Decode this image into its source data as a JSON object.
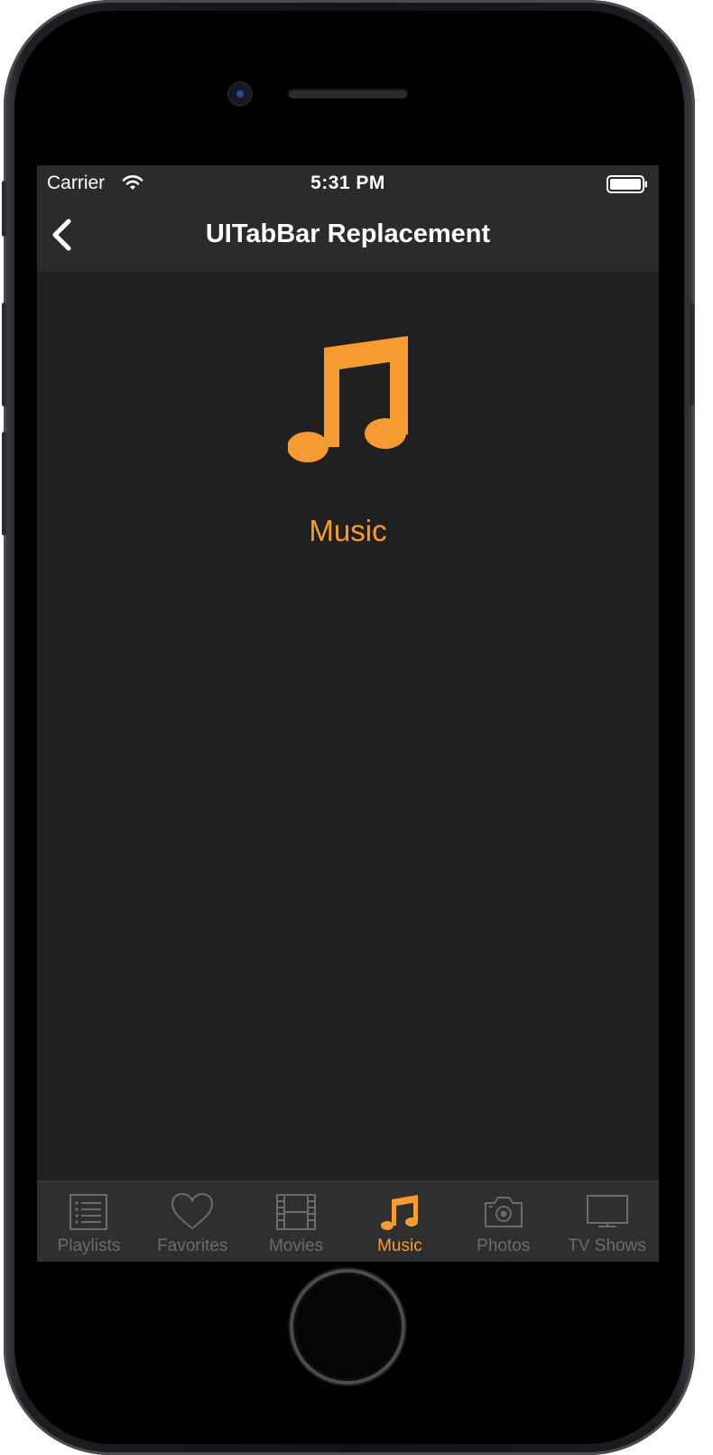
{
  "status_bar": {
    "carrier": "Carrier",
    "time": "5:31 PM"
  },
  "nav_bar": {
    "title": "UITabBar Replacement",
    "back_icon": "chevron-left-icon"
  },
  "content": {
    "icon": "music-note-icon",
    "label": "Music"
  },
  "tab_bar": {
    "tabs": [
      {
        "label": "Playlists",
        "icon": "list-icon",
        "active": false
      },
      {
        "label": "Favorites",
        "icon": "heart-icon",
        "active": false
      },
      {
        "label": "Movies",
        "icon": "film-icon",
        "active": false
      },
      {
        "label": "Music",
        "icon": "music-note-icon",
        "active": true
      },
      {
        "label": "Photos",
        "icon": "camera-icon",
        "active": false
      },
      {
        "label": "TV Shows",
        "icon": "tv-icon",
        "active": false
      }
    ]
  },
  "colors": {
    "accent": "#f59b32",
    "inactive": "#6b6b6b",
    "background": "#202020",
    "bar": "#2b2b2b"
  }
}
